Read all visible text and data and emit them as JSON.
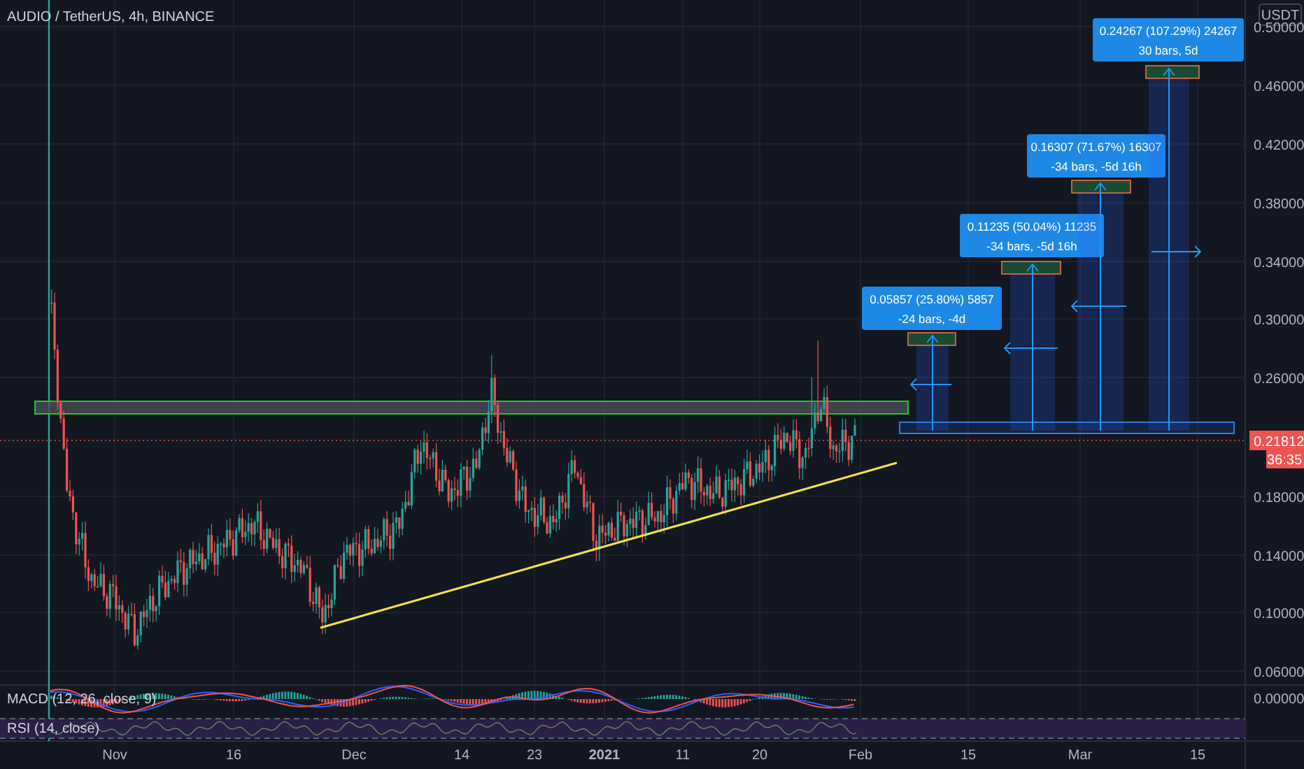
{
  "header": {
    "title": "AUDIO / TetherUS, 4h, BINANCE"
  },
  "price_axis": {
    "currency": "USDT",
    "ticks": [
      "0.50000",
      "0.46000",
      "0.42000",
      "0.38000",
      "0.34000",
      "0.30000",
      "0.26000",
      "0.18000",
      "0.14000",
      "0.10000",
      "0.06000"
    ],
    "last_price": "0.21812",
    "countdown": "36:35"
  },
  "measurements": [
    {
      "line1": "0.05857 (25.80%) 5857",
      "line2": "-24 bars, -4d"
    },
    {
      "line1": "0.11235 (50.04%) 11235",
      "line2": "-34 bars, -5d 16h"
    },
    {
      "line1": "0.16307 (71.67%) 16307",
      "line2": "-34 bars, -5d 16h"
    },
    {
      "line1": "0.24267 (107.29%) 24267",
      "line2": "30 bars, 5d"
    }
  ],
  "indicators": [
    {
      "kind": "macd",
      "label": "MACD (12, 26, close, 9)",
      "axis_value": "0.00000"
    },
    {
      "kind": "rsi",
      "label": "RSI (14, close)"
    }
  ],
  "time_axis": [
    "Nov",
    "16",
    "Dec",
    "14",
    "23",
    "2021",
    "11",
    "20",
    "Feb",
    "15",
    "Mar",
    "15"
  ]
}
